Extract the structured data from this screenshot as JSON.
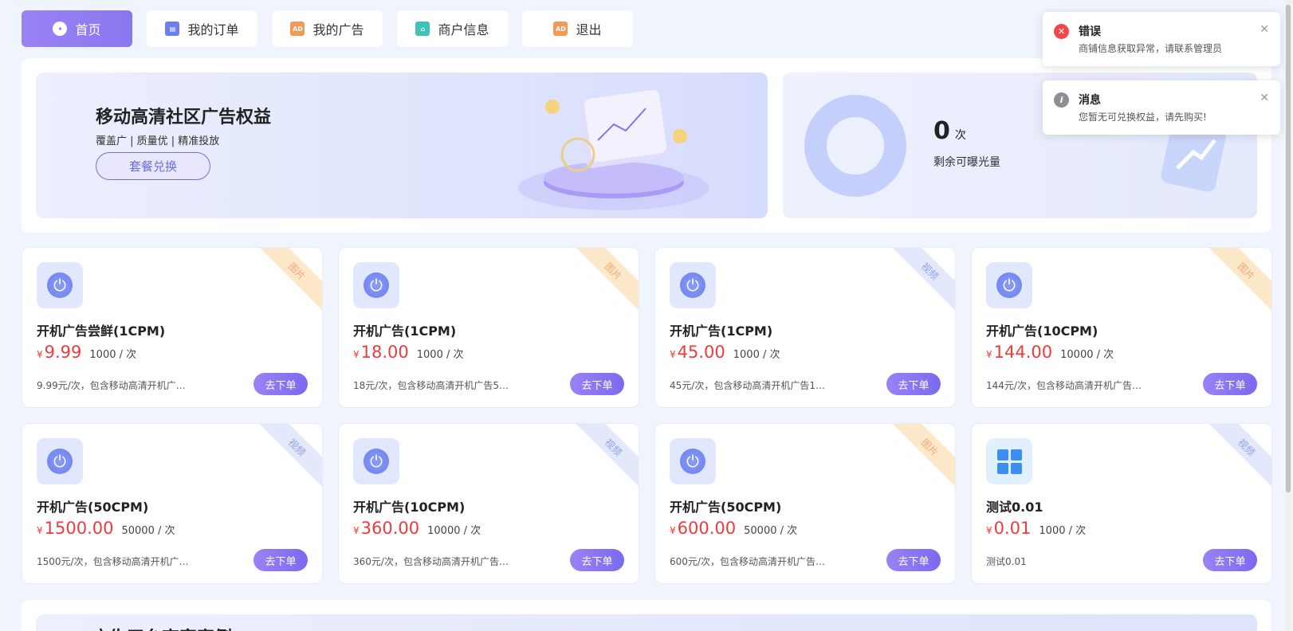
{
  "nav": [
    {
      "label": "首页",
      "icon": "home-icon"
    },
    {
      "label": "我的订单",
      "icon": "order-icon"
    },
    {
      "label": "我的广告",
      "icon": "ad-icon"
    },
    {
      "label": "商户信息",
      "icon": "store-icon"
    },
    {
      "label": "退出",
      "icon": "ad-icon"
    }
  ],
  "banner": {
    "title": "移动高清社区广告权益",
    "subtitle": "覆盖广 | 质量优 | 精准投放",
    "button": "套餐兑换"
  },
  "stats": {
    "count": "0",
    "unit": "次",
    "label": "剩余可曝光量"
  },
  "cards": [
    {
      "title": "开机广告尝鲜(1CPM)",
      "currency": "¥",
      "price": "9.99",
      "unit": "1000 / 次",
      "desc": "9.99元/次，包含移动高清开机广…",
      "tag": "图片",
      "button": "去下单"
    },
    {
      "title": "开机广告(1CPM)",
      "currency": "¥",
      "price": "18.00",
      "unit": "1000 / 次",
      "desc": "18元/次，包含移动高清开机广告5…",
      "tag": "图片",
      "button": "去下单"
    },
    {
      "title": "开机广告(1CPM)",
      "currency": "¥",
      "price": "45.00",
      "unit": "1000 / 次",
      "desc": "45元/次，包含移动高清开机广告1…",
      "tag": "视频",
      "button": "去下单"
    },
    {
      "title": "开机广告(10CPM)",
      "currency": "¥",
      "price": "144.00",
      "unit": "10000 / 次",
      "desc": "144元/次，包含移动高清开机广告…",
      "tag": "图片",
      "button": "去下单"
    },
    {
      "title": "开机广告(50CPM)",
      "currency": "¥",
      "price": "1500.00",
      "unit": "50000 / 次",
      "desc": "1500元/次，包含移动高清开机广…",
      "tag": "视频",
      "button": "去下单"
    },
    {
      "title": "开机广告(10CPM)",
      "currency": "¥",
      "price": "360.00",
      "unit": "10000 / 次",
      "desc": "360元/次，包含移动高清开机广告…",
      "tag": "视频",
      "button": "去下单"
    },
    {
      "title": "开机广告(50CPM)",
      "currency": "¥",
      "price": "600.00",
      "unit": "50000 / 次",
      "desc": "600元/次，包含移动高清开机广告…",
      "tag": "图片",
      "button": "去下单"
    },
    {
      "title": "测试0.01",
      "currency": "¥",
      "price": "0.01",
      "unit": "1000 / 次",
      "desc": "测试0.01",
      "tag": "视频",
      "button": "去下单"
    }
  ],
  "bottom": {
    "title": "广告平台商家案例"
  },
  "notifications": [
    {
      "type": "error",
      "title": "错误",
      "message": "商铺信息获取异常，请联系管理员"
    },
    {
      "type": "info",
      "title": "消息",
      "message": "您暂无可兑换权益，请先购买!"
    }
  ],
  "colors": {
    "accent": "#8a76f0",
    "price": "#ef3b3b",
    "error": "#f1494b"
  }
}
